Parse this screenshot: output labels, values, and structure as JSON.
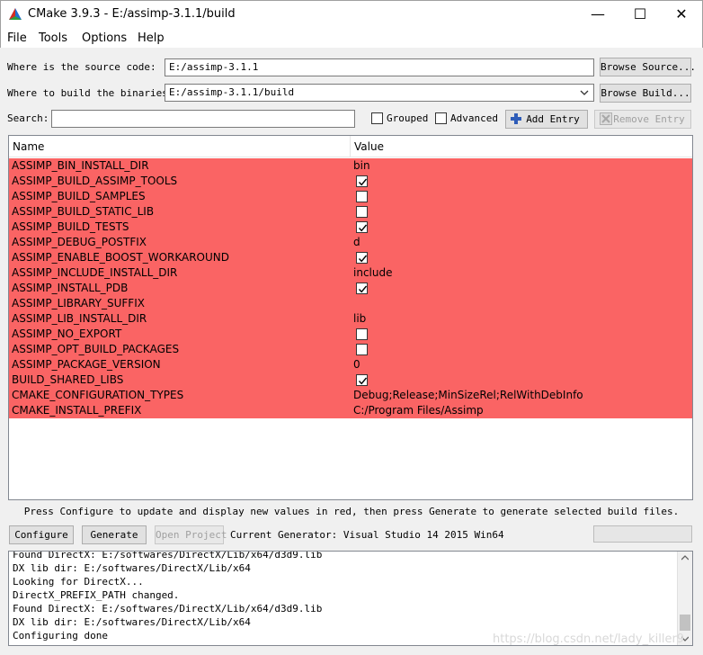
{
  "window": {
    "title": "CMake 3.9.3 - E:/assimp-3.1.1/build",
    "minimize": "—",
    "maximize": "☐",
    "close": "✕"
  },
  "menu": [
    "File",
    "Tools",
    "Options",
    "Help"
  ],
  "source": {
    "label": "Where is the source code:",
    "value": "E:/assimp-3.1.1",
    "browse_label": "Browse Source..."
  },
  "build": {
    "label": "Where to build the binaries:",
    "value": "E:/assimp-3.1.1/build",
    "browse_label": "Browse Build..."
  },
  "search": {
    "label": "Search:",
    "value": "",
    "grouped_label": "Grouped",
    "advanced_label": "Advanced",
    "add_entry_label": "Add Entry",
    "remove_entry_label": "Remove Entry"
  },
  "table": {
    "col_name": "Name",
    "col_value": "Value",
    "rows": [
      {
        "name": "ASSIMP_BIN_INSTALL_DIR",
        "type": "text",
        "value": "bin"
      },
      {
        "name": "ASSIMP_BUILD_ASSIMP_TOOLS",
        "type": "bool",
        "checked": true
      },
      {
        "name": "ASSIMP_BUILD_SAMPLES",
        "type": "bool",
        "checked": false
      },
      {
        "name": "ASSIMP_BUILD_STATIC_LIB",
        "type": "bool",
        "checked": false
      },
      {
        "name": "ASSIMP_BUILD_TESTS",
        "type": "bool",
        "checked": true
      },
      {
        "name": "ASSIMP_DEBUG_POSTFIX",
        "type": "text",
        "value": "d"
      },
      {
        "name": "ASSIMP_ENABLE_BOOST_WORKAROUND",
        "type": "bool",
        "checked": true
      },
      {
        "name": "ASSIMP_INCLUDE_INSTALL_DIR",
        "type": "text",
        "value": "include"
      },
      {
        "name": "ASSIMP_INSTALL_PDB",
        "type": "bool",
        "checked": true
      },
      {
        "name": "ASSIMP_LIBRARY_SUFFIX",
        "type": "text",
        "value": ""
      },
      {
        "name": "ASSIMP_LIB_INSTALL_DIR",
        "type": "text",
        "value": "lib"
      },
      {
        "name": "ASSIMP_NO_EXPORT",
        "type": "bool",
        "checked": false
      },
      {
        "name": "ASSIMP_OPT_BUILD_PACKAGES",
        "type": "bool",
        "checked": false
      },
      {
        "name": "ASSIMP_PACKAGE_VERSION",
        "type": "text",
        "value": "0"
      },
      {
        "name": "BUILD_SHARED_LIBS",
        "type": "bool",
        "checked": true
      },
      {
        "name": "CMAKE_CONFIGURATION_TYPES",
        "type": "text",
        "value": "Debug;Release;MinSizeRel;RelWithDebInfo"
      },
      {
        "name": "CMAKE_INSTALL_PREFIX",
        "type": "text",
        "value": "C:/Program Files/Assimp"
      }
    ],
    "highlight_color": "#fa6464"
  },
  "hint": "Press Configure to update and display new values in red, then press Generate to generate selected build files.",
  "actions": {
    "configure_label": "Configure",
    "generate_label": "Generate",
    "open_project_label": "Open Project",
    "current_generator": "Current Generator: Visual Studio 14 2015 Win64"
  },
  "log": [
    "Found DirectX: E:/softwares/DirectX/Lib/x64/d3d9.lib",
    "DX lib dir: E:/softwares/DirectX/Lib/x64",
    "Looking for DirectX...",
    "DirectX_PREFIX_PATH changed.",
    "Found DirectX: E:/softwares/DirectX/Lib/x64/d3d9.lib",
    "DX lib dir: E:/softwares/DirectX/Lib/x64",
    "Configuring done"
  ],
  "watermark": "https://blog.csdn.net/lady_killer9"
}
